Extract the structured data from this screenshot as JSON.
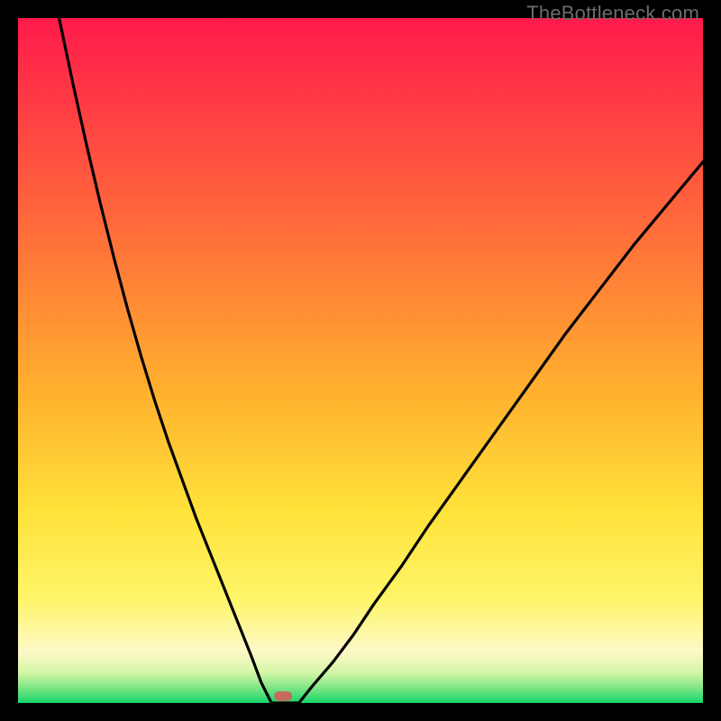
{
  "watermark": {
    "text": "TheBottleneck.com"
  },
  "chart_data": {
    "type": "line",
    "title": "",
    "xlabel": "",
    "ylabel": "",
    "xlim": [
      0,
      100
    ],
    "ylim": [
      0,
      100
    ],
    "grid": false,
    "legend": false,
    "background_gradient": {
      "stops": [
        {
          "offset": 0.0,
          "color": "#ff1a4b"
        },
        {
          "offset": 0.3,
          "color": "#ff6a3b"
        },
        {
          "offset": 0.55,
          "color": "#ffb22e"
        },
        {
          "offset": 0.72,
          "color": "#ffe23a"
        },
        {
          "offset": 0.85,
          "color": "#fff56a"
        },
        {
          "offset": 0.925,
          "color": "#fdf9c7"
        },
        {
          "offset": 0.955,
          "color": "#d5f6a7"
        },
        {
          "offset": 0.975,
          "color": "#8be889"
        },
        {
          "offset": 1.0,
          "color": "#17d56a"
        }
      ]
    },
    "curve_left": {
      "x": [
        6,
        8,
        10,
        12,
        14,
        16,
        18,
        20,
        22,
        24,
        26,
        28,
        30,
        32,
        34,
        35.5,
        37
      ],
      "y": [
        100,
        90.5,
        81.5,
        73,
        65,
        57.5,
        50.5,
        44,
        38,
        32.5,
        27,
        22,
        17,
        12,
        7,
        3,
        0
      ]
    },
    "curve_right": {
      "x": [
        41,
        43,
        46,
        49,
        52,
        56,
        60,
        65,
        70,
        75,
        80,
        85,
        90,
        95,
        100
      ],
      "y": [
        0,
        2.5,
        6,
        10,
        14.5,
        20,
        26,
        33,
        40,
        47,
        54,
        60.5,
        67,
        73,
        79
      ]
    },
    "floor": {
      "x": [
        37,
        41
      ],
      "y": [
        0,
        0
      ]
    },
    "marker": {
      "x": 38.7,
      "y": 1.0,
      "w": 2.6,
      "h": 1.4,
      "color": "#c66a5f"
    }
  }
}
